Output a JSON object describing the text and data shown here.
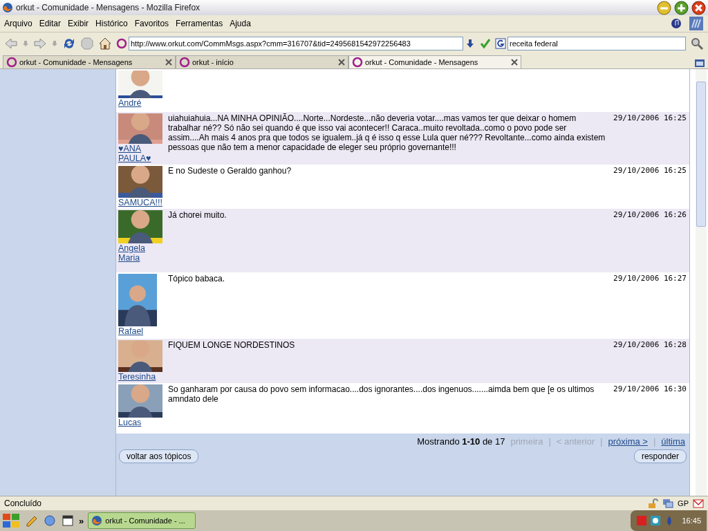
{
  "window": {
    "title": "orkut - Comunidade - Mensagens - Mozilla Firefox"
  },
  "menu": [
    "Arquivo",
    "Editar",
    "Exibir",
    "Histórico",
    "Favoritos",
    "Ferramentas",
    "Ajuda"
  ],
  "address": {
    "value": "http://www.orkut.com/CommMsgs.aspx?cmm=316707&tid=2495681542972256483"
  },
  "search": {
    "value": "receita federal"
  },
  "tabs": [
    {
      "label": "orkut - Comunidade - Mensagens",
      "selected": false
    },
    {
      "label": "orkut - início",
      "selected": false
    },
    {
      "label": "orkut - Comunidade - Mensagens",
      "selected": true
    }
  ],
  "posts": [
    {
      "author": "André"
    },
    {
      "author": "♥ANA PAULA♥",
      "text": "uiahuiahuia...NA MINHA OPINIÃO....Norte...Nordeste...não deveria votar....mas vamos ter que deixar o homem trabalhar né?? Só não sei quando é que isso vai acontecer!! Caraca..muito revoltada..como o povo pode ser assim....Ah mais 4 anos pra que todos se igualem..já q é isso q esse Lula quer né??? Revoltante...como ainda existem pessoas que não tem a menor capacidade de eleger seu próprio governante!!!",
      "time": "29/10/2006 16:25"
    },
    {
      "author": "SAMUCA!!!",
      "text": "E no Sudeste o Geraldo ganhou?",
      "time": "29/10/2006 16:25"
    },
    {
      "author": "Angela Maria",
      "text": "Já chorei muito.",
      "time": "29/10/2006 16:26"
    },
    {
      "author": "Rafael",
      "text": "Tópico babaca.",
      "time": "29/10/2006 16:27"
    },
    {
      "author": "Teresinha",
      "text": "FIQUEM LONGE NORDESTINOS",
      "time": "29/10/2006 16:28"
    },
    {
      "author": "Lucas",
      "text": "So ganharam por causa do povo sem informacao....dos ignorantes....dos ingenuos.......aimda bem que [e os ultimos amndato dele",
      "time": "29/10/2006 16:30"
    }
  ],
  "pagination": {
    "summary": "Mostrando **1-10** de 17",
    "separator": "|",
    "links": [
      {
        "label": "primeira",
        "disabled": true
      },
      {
        "label": "< anterior",
        "disabled": true
      },
      {
        "label": "próxima >",
        "disabled": false
      },
      {
        "label": "última",
        "disabled": false
      }
    ]
  },
  "buttons": [
    "voltar aos tópicos",
    "responder"
  ],
  "status_bar": {
    "text": "Concluído",
    "indicator": "GP"
  },
  "taskbar": {
    "more": "»",
    "task": "orkut - Comunidade - ...",
    "clock": "16:45"
  }
}
